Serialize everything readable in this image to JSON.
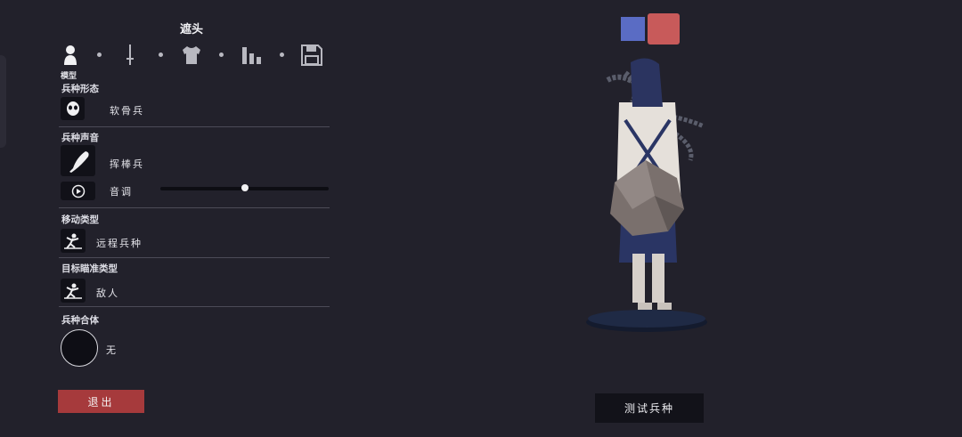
{
  "title": "遮头",
  "tabs": [
    {
      "name": "model",
      "icon": "person-icon",
      "label": "模型",
      "active": true
    },
    {
      "name": "weapon",
      "icon": "sword-icon"
    },
    {
      "name": "clothing",
      "icon": "shirt-icon"
    },
    {
      "name": "stats",
      "icon": "bar-chart-icon"
    },
    {
      "name": "save",
      "icon": "save-icon"
    }
  ],
  "sections": {
    "form": {
      "label": "兵种形态",
      "value": "软骨兵",
      "icon": "skull-mask-icon"
    },
    "voice": {
      "label": "兵种声音",
      "value": "挥棒兵",
      "icon": "club-icon"
    },
    "pitch": {
      "label": "音调",
      "icon": "play-icon",
      "level": 0.5
    },
    "movement": {
      "label": "移动类型",
      "value": "远程兵种",
      "icon": "ranged-unit-icon"
    },
    "targeting": {
      "label": "目标瞄准类型",
      "value": "敌人",
      "icon": "target-enemy-icon"
    },
    "combine": {
      "label": "兵种合体",
      "value": "无"
    }
  },
  "colors": {
    "primary": "#5a6cc4",
    "secondary": "#c85a5a",
    "accent_button": "#a63a3c"
  },
  "buttons": {
    "exit": "退出",
    "test": "测试兵种"
  }
}
